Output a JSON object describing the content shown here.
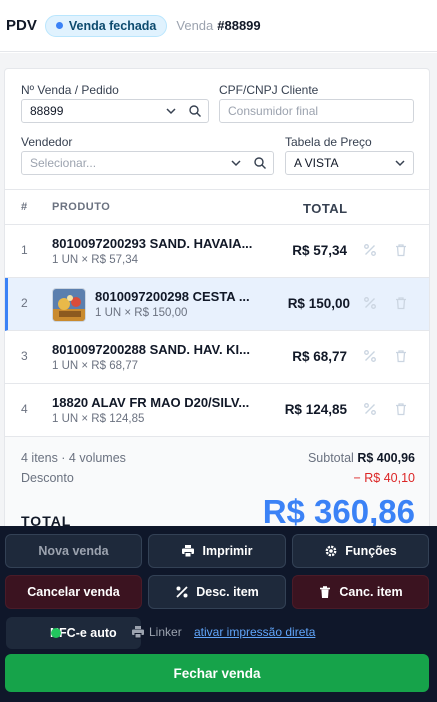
{
  "header": {
    "app_title": "PDV",
    "status": "Venda fechada",
    "sale_label": "Venda",
    "sale_number": "#88899"
  },
  "form": {
    "order_label": "Nº Venda / Pedido",
    "order_value": "88899",
    "cpf_label": "CPF/CNPJ Cliente",
    "cpf_placeholder": "Consumidor final",
    "seller_label": "Vendedor",
    "seller_placeholder": "Selecionar...",
    "price_table_label": "Tabela de Preço",
    "price_table_value": "A VISTA"
  },
  "table": {
    "headers": {
      "index": "#",
      "product": "PRODUTO",
      "total": "TOTAL"
    },
    "rows": [
      {
        "index": "1",
        "name": "8010097200293 SAND. HAVAIA...",
        "sub": "1 UN × R$ 57,34",
        "total": "R$ 57,34",
        "selected": false,
        "has_thumb": false
      },
      {
        "index": "2",
        "name": "8010097200298 CESTA ...",
        "sub": "1 UN × R$ 150,00",
        "total": "R$ 150,00",
        "selected": true,
        "has_thumb": true
      },
      {
        "index": "3",
        "name": "8010097200288 SAND. HAV. KI...",
        "sub": "1 UN × R$ 68,77",
        "total": "R$ 68,77",
        "selected": false,
        "has_thumb": false
      },
      {
        "index": "4",
        "name": "18820 ALAV FR MAO D20/SILV...",
        "sub": "1 UN × R$ 124,85",
        "total": "R$ 124,85",
        "selected": false,
        "has_thumb": false
      }
    ]
  },
  "summary": {
    "items_info": "4 itens · 4 volumes",
    "subtotal_label": "Subtotal",
    "subtotal_value": "R$ 400,96",
    "discount_label": "Desconto",
    "discount_value": "− R$ 40,10",
    "total_label": "TOTAL",
    "total_value": "R$ 360,86"
  },
  "actions": {
    "new_sale": "Nova venda",
    "print": "Imprimir",
    "functions": "Funções",
    "cancel_sale": "Cancelar venda",
    "item_discount": "Desc. item",
    "cancel_item": "Canc. item",
    "nfce": "NFC-e auto",
    "linker": "Linker",
    "direct_print": "ativar impressão direta",
    "close_sale": "Fechar venda"
  },
  "colors": {
    "accent": "#3b82f6",
    "success": "#16a34a",
    "danger": "#dc2626",
    "dark_panel": "#0f172a"
  },
  "icons": [
    "search-icon",
    "chevron-down-icon",
    "discount-icon",
    "trash-icon",
    "printer-icon",
    "gear-icon",
    "percent-icon",
    "status-dot-icon"
  ]
}
